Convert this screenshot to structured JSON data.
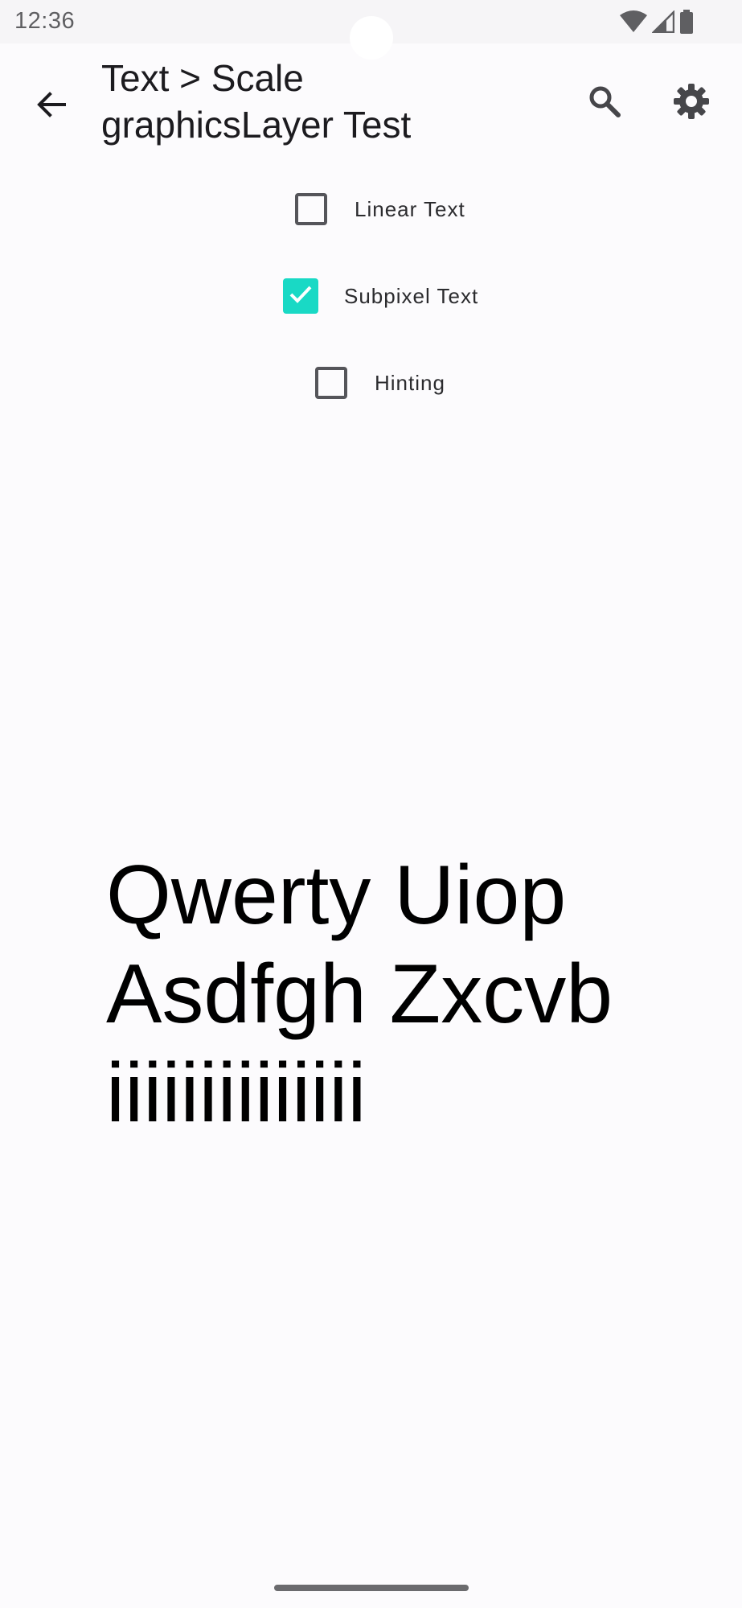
{
  "status_bar": {
    "time": "12:36",
    "icons": [
      "wifi-icon",
      "signal-icon",
      "battery-icon"
    ]
  },
  "app_bar": {
    "title_line1": "Text > Scale",
    "title_line2": "graphicsLayer Test",
    "back_icon": "arrow-back-icon",
    "search_icon": "search-icon",
    "settings_icon": "gear-icon"
  },
  "options": [
    {
      "label": "Linear Text",
      "checked": false
    },
    {
      "label": "Subpixel Text",
      "checked": true
    },
    {
      "label": "Hinting",
      "checked": false
    }
  ],
  "sample": {
    "line1": "Qwerty Uiop",
    "line2": "Asdfgh Zxcvb",
    "line3": "iiiiiiiiiiiiii"
  },
  "colors": {
    "accent": "#19d9c5",
    "background": "#fcfbfd"
  }
}
